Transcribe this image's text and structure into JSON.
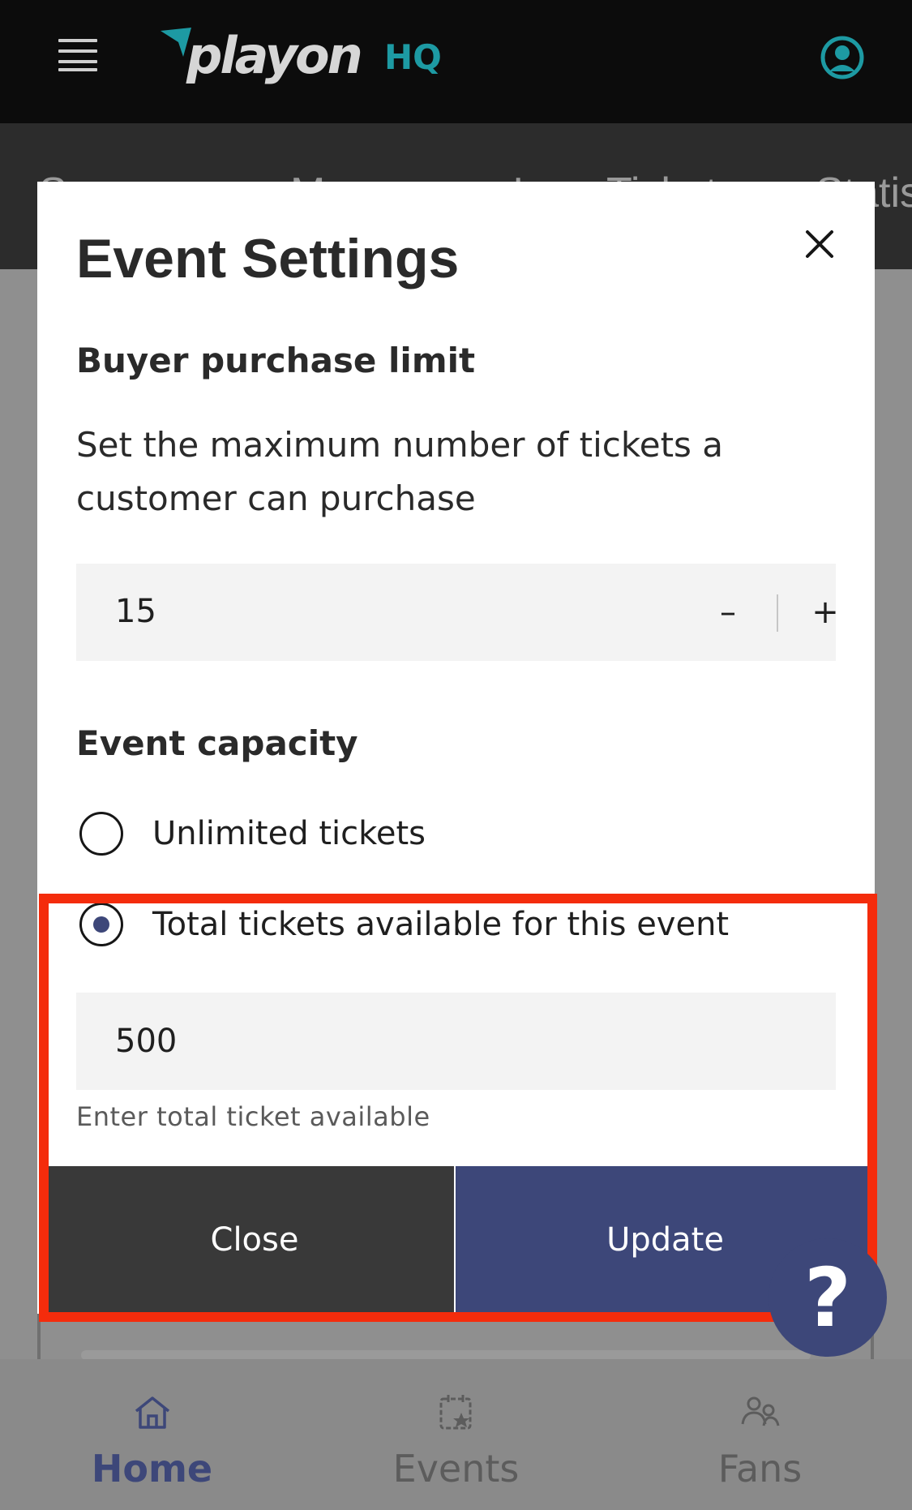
{
  "app": {
    "logo_text": "playon",
    "logo_suffix": "HQ",
    "brand_color": "#1d9aa3",
    "accent_color": "#3d4779",
    "annotation_color": "#f42c0c"
  },
  "topbar": {
    "menu_icon": "hamburger-icon",
    "profile_icon": "user-avatar-icon"
  },
  "subnav": {
    "tabs": [
      "S",
      "M",
      "I",
      "Tickets",
      "Statis"
    ]
  },
  "modal": {
    "title": "Event Settings",
    "close_icon": "close-icon",
    "purchase_limit": {
      "heading": "Buyer purchase limit",
      "description": "Set the maximum number of tickets a customer can purchase",
      "value": "15",
      "decrement_label": "–",
      "increment_label": "+"
    },
    "capacity": {
      "heading": "Event capacity",
      "options": [
        {
          "label": "Unlimited tickets",
          "selected": false
        },
        {
          "label": "Total tickets available for this event",
          "selected": true
        }
      ],
      "total_value": "500",
      "helper_text": "Enter total ticket available"
    },
    "buttons": {
      "close_label": "Close",
      "update_label": "Update"
    }
  },
  "help": {
    "label": "?"
  },
  "bottom_nav": {
    "items": [
      {
        "label": "Home",
        "icon": "home-icon",
        "active": true
      },
      {
        "label": "Events",
        "icon": "calendar-star-icon",
        "active": false
      },
      {
        "label": "Fans",
        "icon": "users-icon",
        "active": false
      }
    ]
  }
}
